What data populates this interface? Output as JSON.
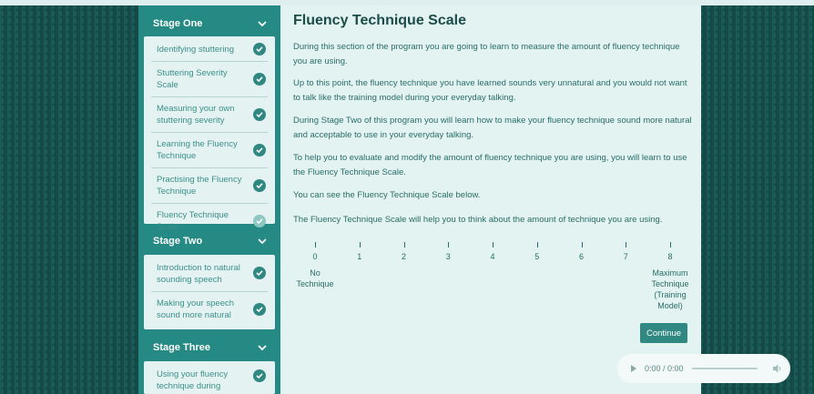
{
  "sidebar": {
    "stages": [
      {
        "title": "Stage One",
        "items": [
          {
            "label": "Identifying stuttering",
            "done": true
          },
          {
            "label": "Stuttering Severity Scale",
            "done": true
          },
          {
            "label": "Measuring your own stuttering severity",
            "done": true
          },
          {
            "label": "Learning the Fluency Technique",
            "done": true
          },
          {
            "label": "Practising the Fluency Technique",
            "done": true
          },
          {
            "label": "Fluency Technique Scale",
            "done": true,
            "current": true
          }
        ]
      },
      {
        "title": "Stage Two",
        "items": [
          {
            "label": "Introduction to natural sounding speech",
            "done": true
          },
          {
            "label": "Making your speech sound more natural",
            "done": true
          }
        ]
      },
      {
        "title": "Stage Three",
        "items": [
          {
            "label": "Using your fluency technique during",
            "done": true
          }
        ]
      }
    ]
  },
  "main": {
    "title": "Fluency Technique Scale",
    "paragraphs": [
      "During this section of the program you are going to learn to measure the amount of fluency technique you are using.",
      "Up to this point, the fluency technique you have learned sounds very unnatural and you would not want to talk like the training model during your everyday talking.",
      "During Stage Two of this program you will learn how to make your fluency technique sound more natural and acceptable to use in your everyday talking.",
      "To help you to evaluate and modify the amount of fluency technique you are using, you will learn to use the Fluency Technique Scale.",
      "You can see the Fluency Technique Scale below.",
      "The Fluency Technique Scale will help you to think about the amount of technique you are using."
    ],
    "scale": {
      "numbers": [
        "0",
        "1",
        "2",
        "3",
        "4",
        "5",
        "6",
        "7",
        "8"
      ],
      "min_label": "No\nTechnique",
      "max_label": "Maximum\nTechnique\n(Training Model)"
    },
    "continue_label": "Continue"
  },
  "audio": {
    "time": "0:00 / 0:00",
    "progress": 0
  },
  "colors": {
    "accent": "#2f8882",
    "sidebar_bg": "#258a83",
    "content_bg": "#e2f3f2",
    "heading": "#1b4c48"
  }
}
